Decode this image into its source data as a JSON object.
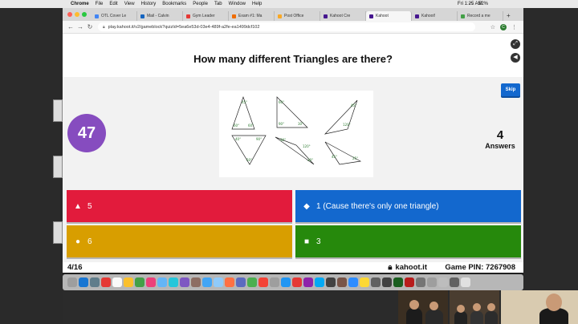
{
  "menubar": {
    "app": "Chrome",
    "menus": [
      "File",
      "Edit",
      "View",
      "History",
      "Bookmarks",
      "People",
      "Tab",
      "Window",
      "Help"
    ],
    "battery": "52%",
    "clock": "Fri 1:25 AM"
  },
  "tabs": [
    {
      "label": "OTL Cover Le",
      "color": "#4285f4"
    },
    {
      "label": "Mail - Calvin",
      "color": "#1565c0"
    },
    {
      "label": "Gym Leader",
      "color": "#e53935"
    },
    {
      "label": "Exam #1: Ma",
      "color": "#ef6c00"
    },
    {
      "label": "Post Office",
      "color": "#f9a825"
    },
    {
      "label": "Kahoot Cre",
      "color": "#46178f"
    },
    {
      "label": "Kahoot",
      "color": "#46178f"
    },
    {
      "label": "Kahoot!",
      "color": "#46178f"
    },
    {
      "label": "Record a me",
      "color": "#43a047"
    }
  ],
  "address": {
    "url": "play.kahoot.it/v2/gameblock?quizId=5ea6e53d-03e4-489f-a2fe-ea1499dcf102"
  },
  "question": {
    "title": "How many different Triangles are there?",
    "timer": "47",
    "answer_count": "4",
    "answer_label": "Answers",
    "skip": "Skip"
  },
  "figure": {
    "labels": [
      "45°",
      "60°",
      "60°",
      "60°",
      "90°",
      "30°",
      "45°",
      "120°",
      "40°",
      "90°",
      "50°",
      "120°",
      "30°",
      "30°",
      "45°",
      "25°"
    ]
  },
  "options": [
    {
      "shape": "▲",
      "text": "5",
      "color": "#e21b3c"
    },
    {
      "shape": "◆",
      "text": "1 (Cause there's only one triangle)",
      "color": "#1368ce"
    },
    {
      "shape": "●",
      "text": "6",
      "color": "#d89e00"
    },
    {
      "shape": "■",
      "text": "3",
      "color": "#26890c"
    }
  ],
  "footer": {
    "progress": "4/16",
    "brand": "kahoot.it",
    "pin_label": "Game PIN:",
    "pin": "7267908"
  },
  "dock_colors": [
    "#9e9e9e",
    "#1976d2",
    "#607d8b",
    "#e53935",
    "#fafafa",
    "#fbc02d",
    "#43a047",
    "#ec407a",
    "#64b5f6",
    "#26c6da",
    "#7e57c2",
    "#8d6e63",
    "#42a5f5",
    "#90caf9",
    "#ff7043",
    "#5c6bc0",
    "#4caf50",
    "#f44336",
    "#9e9e9e",
    "#2196f3",
    "#e53935",
    "#8e24aa",
    "#03a9f4",
    "#424242",
    "#795548",
    "#2d8cff",
    "#fdd835",
    "#616161",
    "#424242",
    "#1b5e20",
    "#b71c1c",
    "#757575",
    "#9e9e9e",
    "#bdbdbd",
    "#616161",
    "#e0e0e0"
  ]
}
